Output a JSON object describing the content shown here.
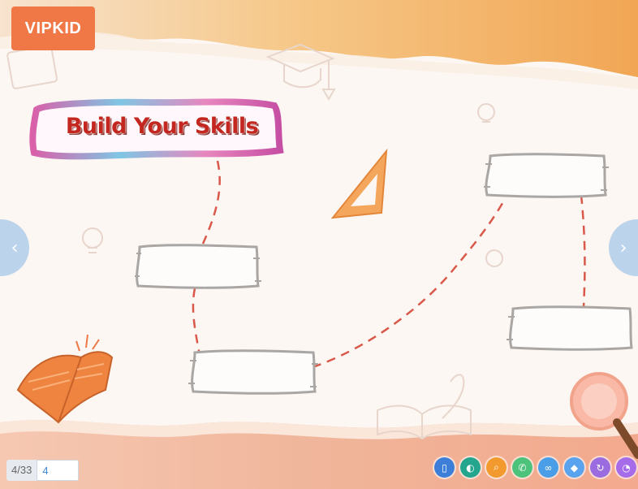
{
  "logo": {
    "text": "VIPKID",
    "color": "#f07746"
  },
  "slide": {
    "title": "Build Your Skills",
    "title_color": "#c3271f",
    "background": "#fcf7f3",
    "accent_orange": "#f4a75c",
    "path_color": "#d9584a"
  },
  "navigation": {
    "prev_icon": "chevron-left-icon",
    "next_icon": "chevron-right-icon",
    "prev_glyph": "‹",
    "next_glyph": "›"
  },
  "pager": {
    "count_text": "4/33",
    "input_value": "4"
  },
  "toolbar": {
    "tools": [
      {
        "icon": "slides-icon",
        "glyph": "▯",
        "color": "#3d7fd8"
      },
      {
        "icon": "globe-icon",
        "glyph": "◐",
        "color": "#23a58e"
      },
      {
        "icon": "search-icon",
        "glyph": "⌕",
        "color": "#f29a2e"
      },
      {
        "icon": "chat-icon",
        "glyph": "✆",
        "color": "#4cc27a"
      },
      {
        "icon": "link-icon",
        "glyph": "∞",
        "color": "#4a9ee8"
      },
      {
        "icon": "eraser-icon",
        "glyph": "◆",
        "color": "#5aa3ee"
      },
      {
        "icon": "refresh-icon",
        "glyph": "↻",
        "color": "#9b6be0"
      },
      {
        "icon": "clock-icon",
        "glyph": "◔",
        "color": "#a56be8"
      }
    ]
  }
}
